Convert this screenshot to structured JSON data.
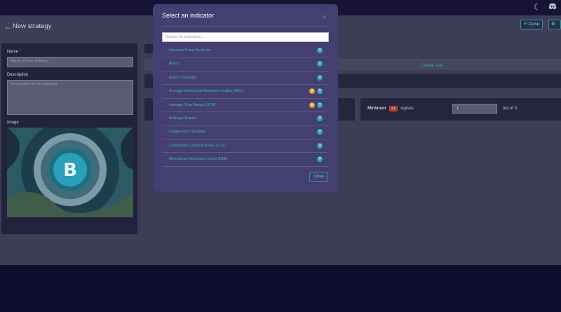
{
  "topbar": {
    "theme_icon": "moon-icon",
    "discord_icon": "discord-icon"
  },
  "header": {
    "back_icon": "back-arrow-icon",
    "title": "New strategy",
    "close_label": "Close"
  },
  "form": {
    "name_label": "Name",
    "name_required": "*",
    "name_placeholder": "Name of your strategy",
    "description_label": "Description",
    "description_placeholder": "Description of your strategy",
    "image_label": "Image"
  },
  "main": {
    "candle_size_label": "Candle size",
    "minimum_label": "Minimum",
    "minimum_badge": "+1",
    "signals_label": "signals:",
    "minimum_value": "1",
    "out_of_label": "out of 0."
  },
  "modal": {
    "title": "Select an indicator",
    "close_icon": "×",
    "search_placeholder": "Search for indicators...",
    "footer_close_label": "Close",
    "items": [
      {
        "label": "Absolute Price Oscillator",
        "premium": false
      },
      {
        "label": "Aroon",
        "premium": false
      },
      {
        "label": "Aroon Oscillator",
        "premium": false
      },
      {
        "label": "Average Directional Movement Index (ADX)",
        "premium": true
      },
      {
        "label": "Average True Range (ATR)",
        "premium": true
      },
      {
        "label": "Bollinger Bands",
        "premium": false
      },
      {
        "label": "Chaikin A/D Oscillator",
        "premium": false
      },
      {
        "label": "Commodity Channel Index (CCI)",
        "premium": false
      },
      {
        "label": "Directional Movement Index (DMI)",
        "premium": false
      }
    ]
  },
  "colors": {
    "accent": "#2ea6b5",
    "modal_bg": "#433f70",
    "premium": "#e8a020"
  }
}
